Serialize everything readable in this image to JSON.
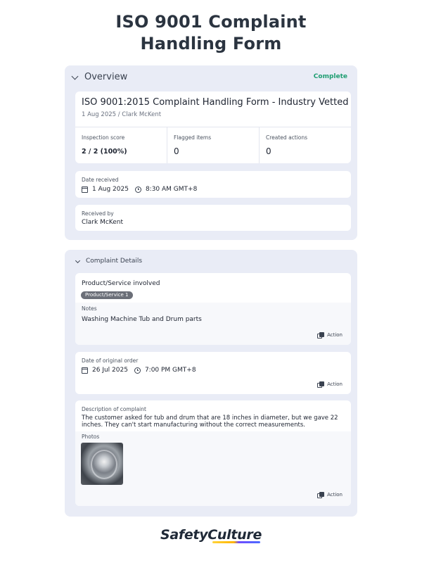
{
  "page": {
    "title": "ISO 9001 Complaint\nHandling Form"
  },
  "overview": {
    "header": "Overview",
    "status": "Complete",
    "report_title": "ISO 9001:2015 Complaint Handling Form - Industry Vetted",
    "report_subtitle": "1 Aug 2025 / Clark McKent",
    "stats": [
      {
        "label": "Inspection score",
        "value": "2 / 2 (100%)"
      },
      {
        "label": "Flagged items",
        "value": "0"
      },
      {
        "label": "Created actions",
        "value": "0"
      }
    ],
    "date_received": {
      "label": "Date received",
      "date": "1 Aug 2025",
      "time": "8:30 AM GMT+8"
    },
    "received_by": {
      "label": "Received by",
      "value": "Clark McKent"
    }
  },
  "complaint_details": {
    "header": "Complaint Details",
    "product": {
      "label": "Product/Service involved",
      "badge": "Product/Service 1",
      "notes_label": "Notes",
      "notes_value": "Washing Machine Tub and Drum parts",
      "action_label": "Action"
    },
    "original_order": {
      "label": "Date of original order",
      "date": "26 Jul 2025",
      "time": "7:00 PM GMT+8",
      "action_label": "Action"
    },
    "description": {
      "label": "Description of complaint",
      "text": "The customer asked for tub and drum that are 18 inches in diameter, but we gave 22 inches. They can't start manufacturing without the correct measurements.",
      "photos_label": "Photos",
      "action_label": "Action"
    }
  },
  "brand": {
    "name": "SafetyCulture"
  },
  "colors": {
    "section_bg": "#e9ecf6",
    "status_green": "#1f9e72",
    "badge_gray": "#6b6f78"
  }
}
